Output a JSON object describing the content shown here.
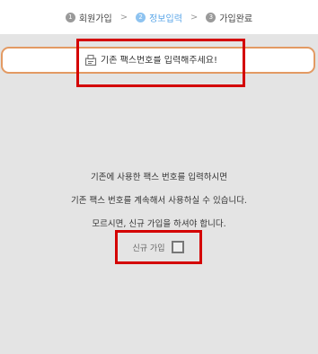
{
  "steps": [
    {
      "num": "1",
      "label": "회원가입"
    },
    {
      "num": "2",
      "label": "정보입력"
    },
    {
      "num": "3",
      "label": "가입완료"
    }
  ],
  "separator": ">",
  "fax_input": {
    "placeholder": "기존 팩스번호를 입력해주세요!",
    "value": ""
  },
  "message_lines": [
    "기존에 사용한 팩스 번호를 입력하시면",
    "기존 팩스 번호를 계속해서 사용하실 수 있습니다.",
    "모르시면, 신규 가입을 하셔야 합니다."
  ],
  "new_join": {
    "label": "신규 가입",
    "checked": false
  },
  "colors": {
    "active_step": "#5aa6e8",
    "input_border": "#e39a63",
    "highlight": "#d40000"
  }
}
